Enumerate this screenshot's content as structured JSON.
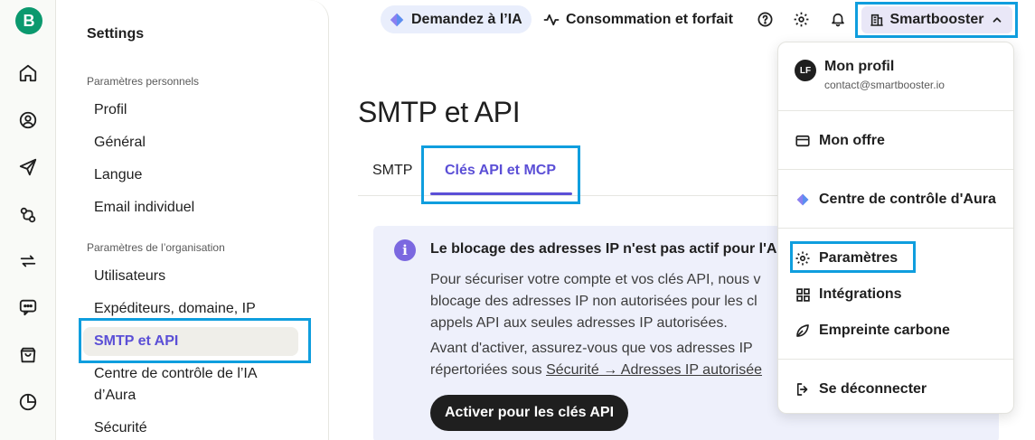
{
  "app": {
    "logo_letter": "B",
    "brand_color": "#0b996e",
    "accent_color": "#5b4fd6",
    "highlight_color": "#0f9ede"
  },
  "rail": {
    "icons": [
      "home-icon",
      "contacts-icon",
      "campaigns-icon",
      "automations-icon",
      "conversations-icon",
      "chat-icon",
      "ecommerce-icon",
      "analytics-icon"
    ]
  },
  "sidebar": {
    "title": "Settings",
    "personal_label": "Paramètres personnels",
    "personal_items": [
      "Profil",
      "Général",
      "Langue",
      "Email individuel"
    ],
    "org_label": "Paramètres de l’organisation",
    "org_items": [
      "Utilisateurs",
      "Expéditeurs, domaine, IP",
      "SMTP et API",
      "Centre de contrôle de l’IA d’Aura",
      "Sécurité"
    ],
    "active_item": "SMTP et API"
  },
  "topbar": {
    "ask_ai": "Demandez à l’IA",
    "consumption": "Consommation et forfait",
    "account": "Smartbooster"
  },
  "main": {
    "title": "SMTP et API",
    "tabs": [
      "SMTP",
      "Clés API et MCP"
    ],
    "active_tab": "Clés API et MCP",
    "info": {
      "icon_letter": "i",
      "title": "Le blocage des adresses IP n'est pas actif pour l'A",
      "line1": "Pour sécuriser votre compte et vos clés API, nous v",
      "line2": "blocage des adresses IP non autorisées pour les cl",
      "line3": "appels API aux seules adresses IP autorisées.",
      "line4": "Avant d'activer, assurez-vous que vos adresses IP",
      "line5_prefix": "répertoriées sous ",
      "line5_link": "Sécurité → Adresses IP autorisée",
      "button": "Activer pour les clés API"
    }
  },
  "menu": {
    "avatar_initials": "LF",
    "profile_name": "Mon profil",
    "profile_email": "contact@smartbooster.io",
    "items": [
      "Mon offre",
      "Centre de contrôle d'Aura",
      "Paramètres",
      "Intégrations",
      "Empreinte carbone",
      "Se déconnecter"
    ]
  }
}
